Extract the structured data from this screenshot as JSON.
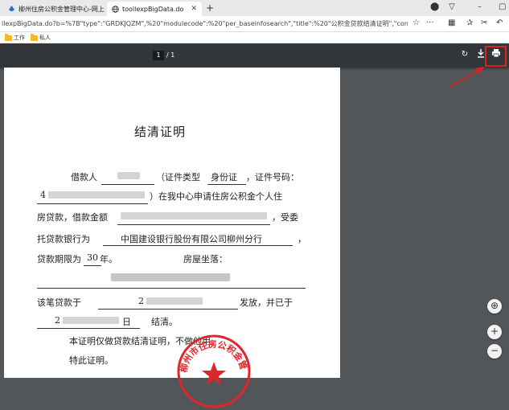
{
  "browser": {
    "tabs": [
      {
        "label": "柳州住房公积金管理中心-网上",
        "active": false
      },
      {
        "label": "toollexpBigData.do",
        "active": true
      }
    ],
    "url": "llexpBigData.do?b=%7B\"type\":\"GRDKJQZM\",%20\"modulecode\":%20\"per_baseinfosearch\",\"title\":%20\"公积金贷款结清证明\",\"contype\":\"1\",\"",
    "bookmarks": [
      "工作",
      "私人"
    ]
  },
  "pdf_viewer": {
    "current_page": "1",
    "page_total": "/ 1"
  },
  "document": {
    "title": "结清证明",
    "line1_a": "借款人",
    "line1_b": "（证件类型",
    "id_type": "身份证",
    "line1_c": "，证件号码：",
    "id_prefix": "4",
    "line2_b": "）在我中心申请住房公积金个人住",
    "line3_a": "房贷款，借款金额",
    "line3_b": "，受委",
    "line4_a": "托贷款银行为",
    "bank": "中国建设银行股份有限公司柳州分行",
    "line4_b": "，",
    "line5_a": "贷款期限为",
    "term": "30",
    "line5_b": "年。",
    "line5_c": "房屋坐落：",
    "line7_a": "该笔贷款于",
    "date_prefix": "2",
    "line7_b": "发放，并已于",
    "date2_prefix": "2",
    "line8_b": "日",
    "line8_c": "结清。",
    "line9": "本证明仅做贷款结清证明，不做他用。",
    "line10": "特此证明。",
    "seal_text": "柳州市住房公积金管理中心"
  },
  "colors": {
    "highlight": "#e02020",
    "toolbar": "#323639",
    "background": "#525659",
    "seal": "#e0262b"
  }
}
